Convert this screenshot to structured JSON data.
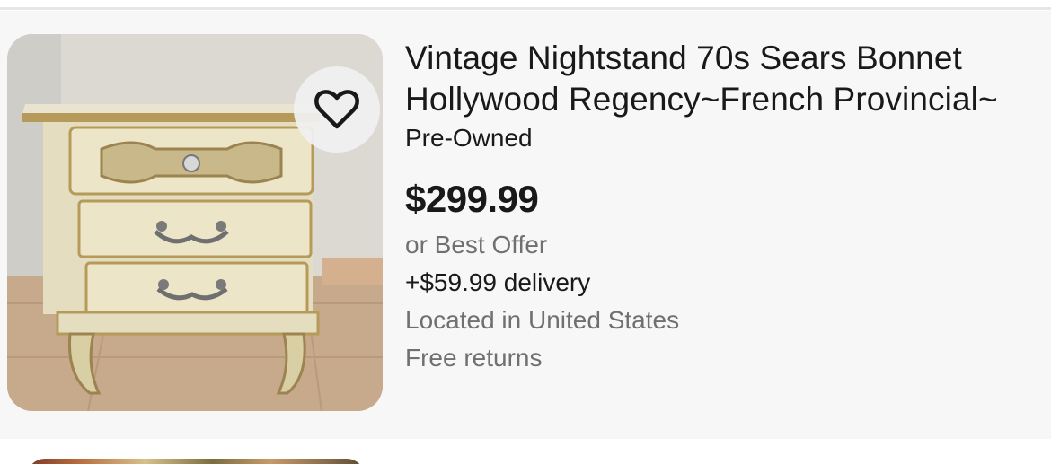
{
  "listing": {
    "title": "Vintage Nightstand 70s Sears Bonnet Hollywood Regency~French Provincial~",
    "condition": "Pre-Owned",
    "price": "$299.99",
    "offer": "or Best Offer",
    "delivery": "+$59.99 delivery",
    "location": "Located in United States",
    "returns": "Free returns",
    "image_alt": "Vintage French Provincial nightstand with three drawers",
    "watch_icon": "heart-icon"
  },
  "colors": {
    "primary_text": "#191919",
    "secondary_text": "#707070",
    "card_background": "#f7f7f7"
  }
}
